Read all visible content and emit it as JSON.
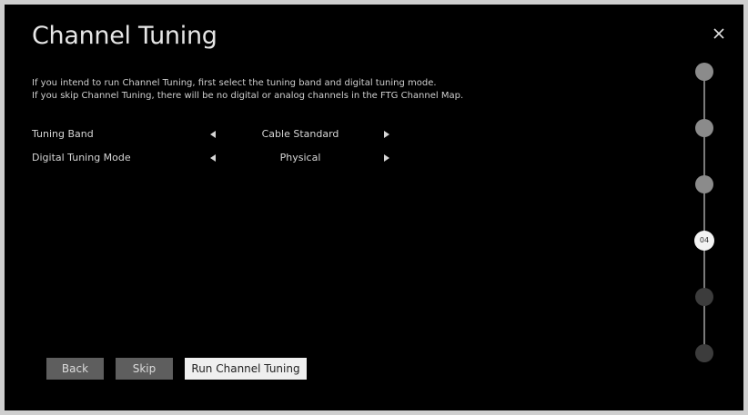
{
  "dialog": {
    "title": "Channel Tuning",
    "close_icon": "close-icon",
    "description": [
      "If you intend to run Channel Tuning, first select the tuning band and digital tuning mode.",
      "If you skip Channel Tuning, there will be no digital or analog channels in the FTG Channel Map."
    ]
  },
  "settings": [
    {
      "label": "Tuning Band",
      "value": "Cable Standard"
    },
    {
      "label": "Digital Tuning Mode",
      "value": "Physical"
    }
  ],
  "buttons": {
    "back": "Back",
    "skip": "Skip",
    "run": "Run Channel Tuning"
  },
  "stepper": {
    "total_steps": 6,
    "current_step": 4,
    "current_label": "04"
  },
  "colors": {
    "background": "#000000",
    "step_done": "#8b8b8b",
    "step_future": "#3c3c3c",
    "step_current": "#f3f3f3",
    "primary_button": "#efefef",
    "secondary_button": "#5e5e5e"
  }
}
